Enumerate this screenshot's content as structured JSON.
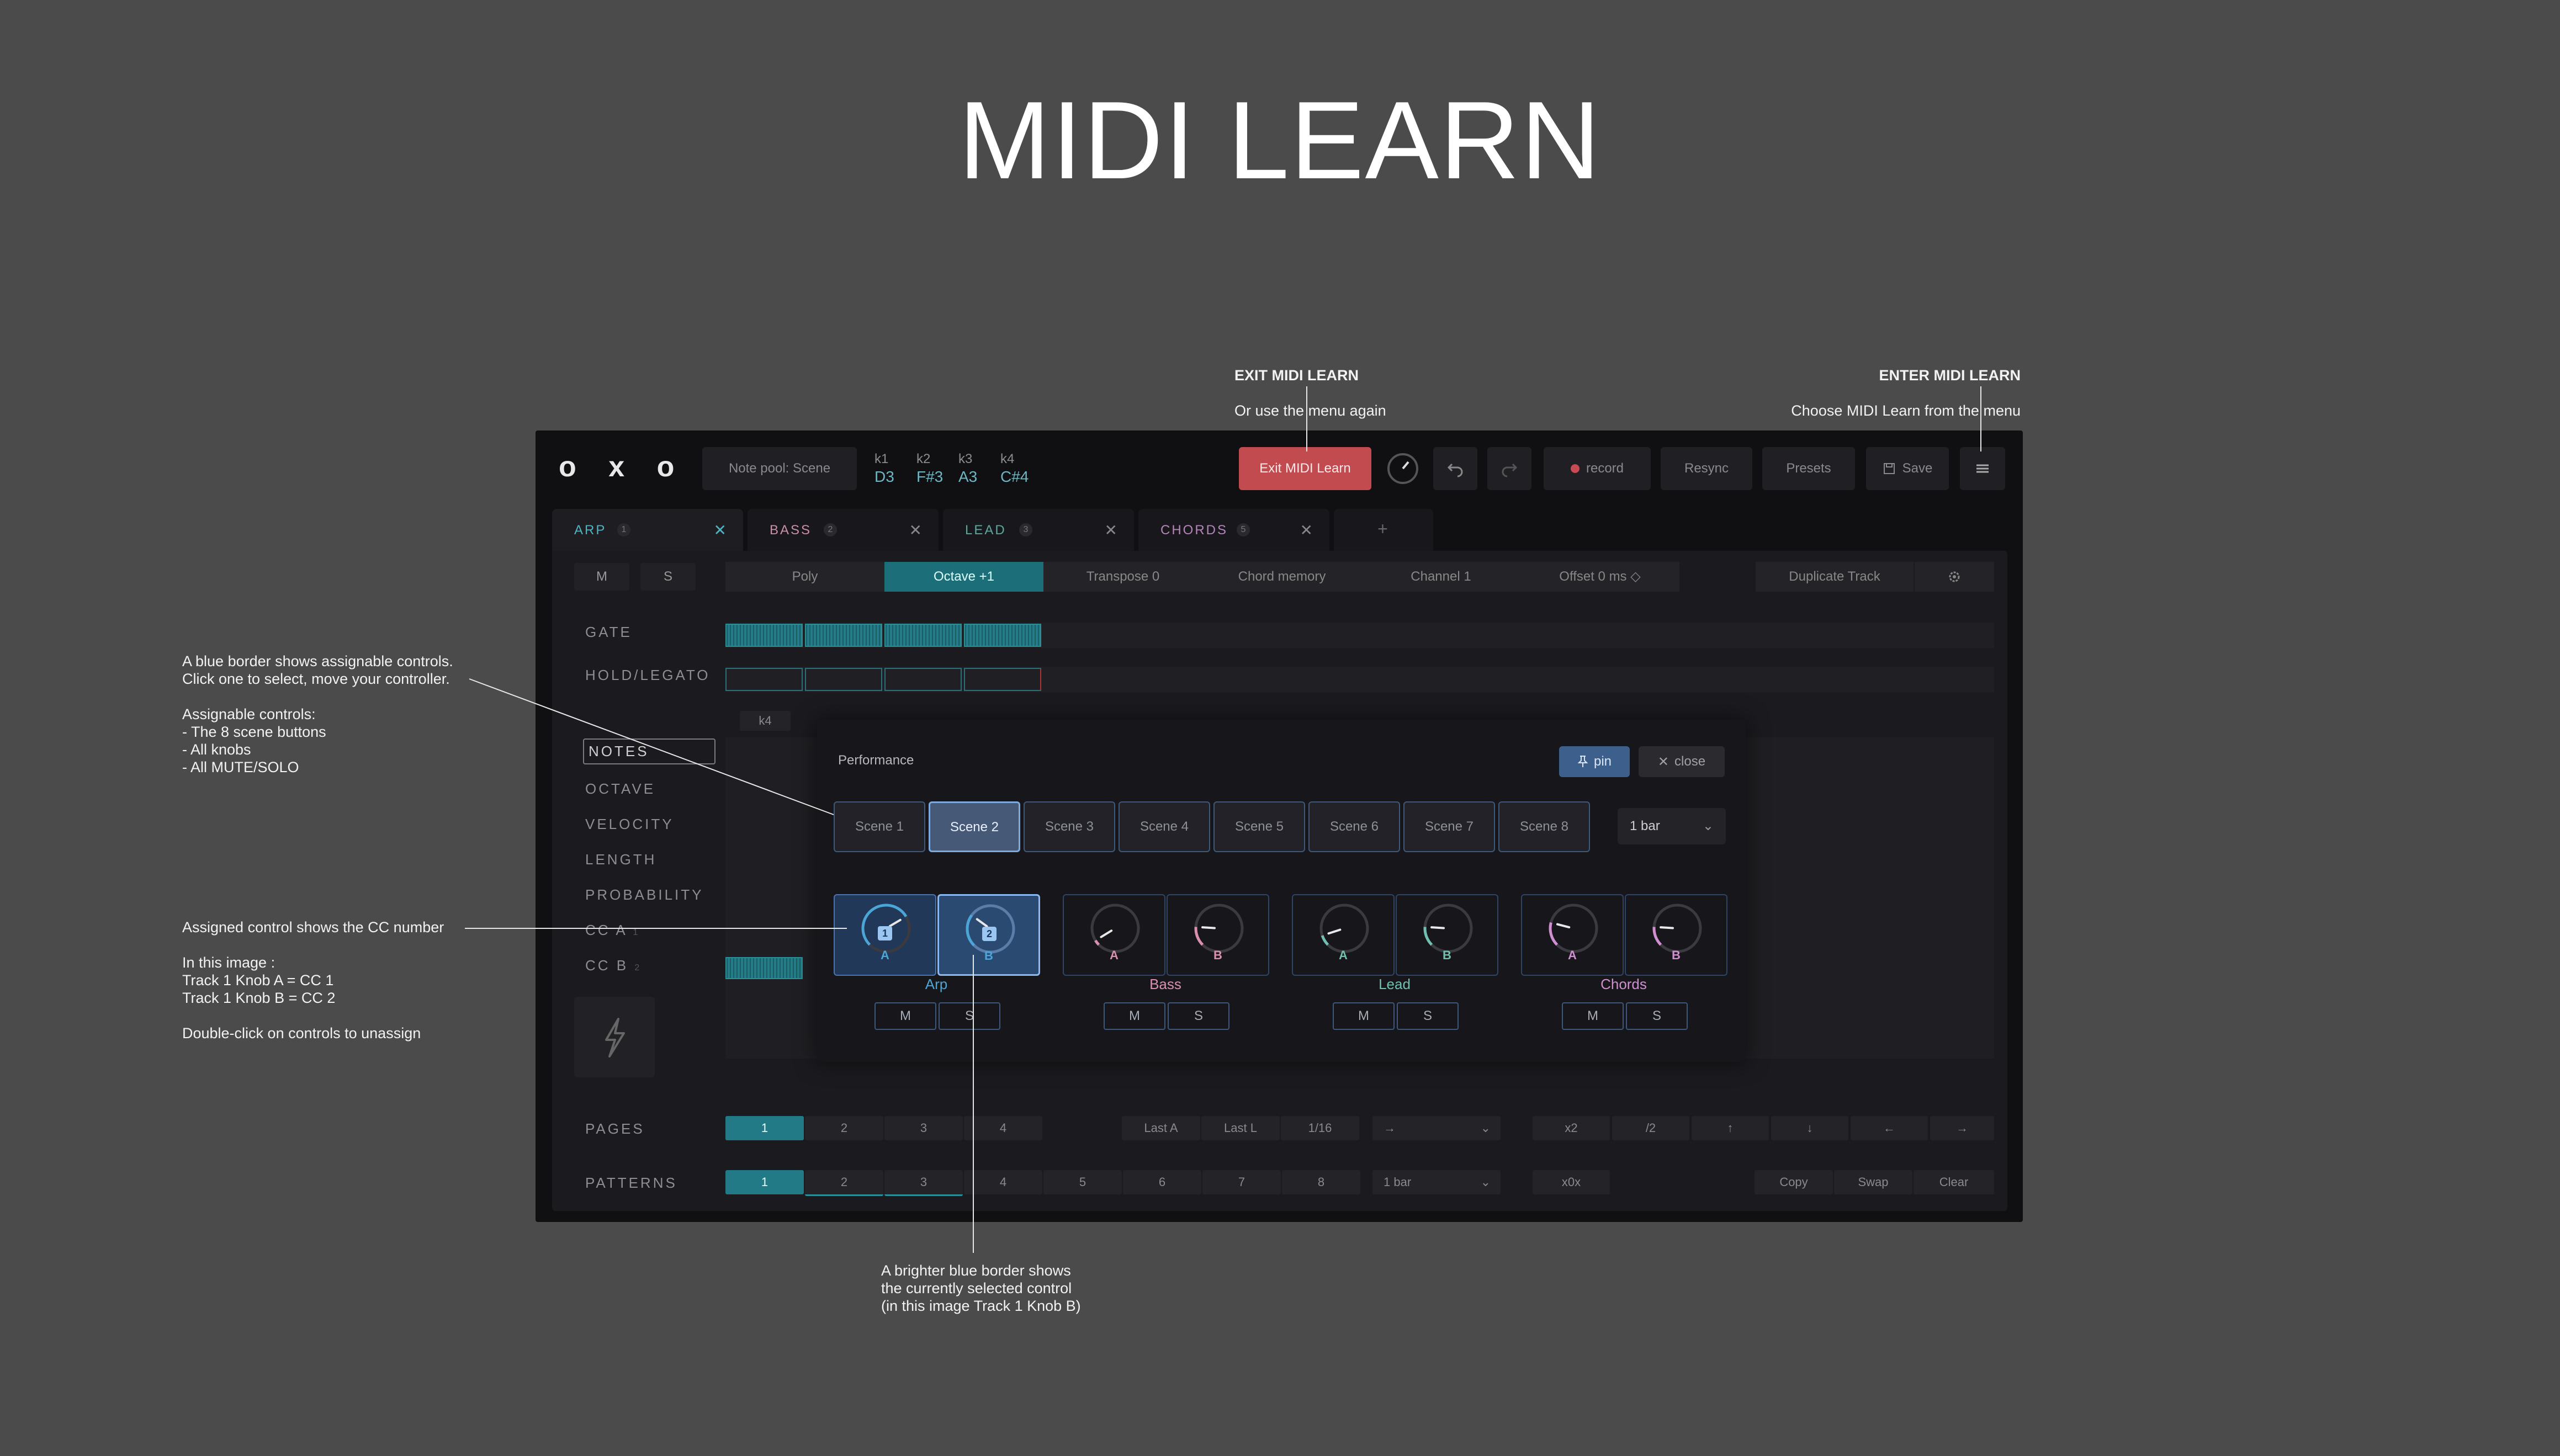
{
  "title": "MIDI LEARN",
  "annotations": {
    "exit": {
      "heading": "EXIT MIDI LEARN",
      "text": "Or use the menu again"
    },
    "enter": {
      "heading": "ENTER MIDI LEARN",
      "text": "Choose MIDI Learn from the menu"
    },
    "blue_border": {
      "text": "A blue border shows assignable controls.\nClick one to select, move your controller.\n\nAssignable controls:\n- The 8 scene buttons\n- All knobs\n- All MUTE/SOLO"
    },
    "assigned": {
      "text": "Assigned control shows the CC number\n\nIn this image :\nTrack 1 Knob A = CC 1\nTrack 1 Knob B = CC 2\n\nDouble-click on controls to unassign"
    },
    "brighter": {
      "text": "A brighter blue border shows\nthe currently selected control\n(in this image Track 1 Knob B)"
    }
  },
  "app": {
    "logo": "o x o",
    "note_pool": "Note pool: Scene",
    "keys": [
      {
        "label": "k1",
        "note": "D3"
      },
      {
        "label": "k2",
        "note": "F#3"
      },
      {
        "label": "k3",
        "note": "A3"
      },
      {
        "label": "k4",
        "note": "C#4"
      }
    ],
    "exit_midi_learn": "Exit MIDI Learn",
    "record": "record",
    "resync": "Resync",
    "presets": "Presets",
    "save": "Save",
    "tabs": [
      {
        "name": "ARP",
        "num": "1",
        "color": "#4fb3c2"
      },
      {
        "name": "BASS",
        "num": "2",
        "color": "#c98fa6"
      },
      {
        "name": "LEAD",
        "num": "3",
        "color": "#5fa79d"
      },
      {
        "name": "CHORDS",
        "num": "5",
        "color": "#b586b9"
      }
    ],
    "add_tab": "+",
    "mute": "M",
    "solo": "S",
    "options": [
      "Poly",
      "Octave +1",
      "Transpose 0",
      "Chord memory",
      "Channel 1",
      "Offset 0 ms ◇"
    ],
    "duplicate_track": "Duplicate Track",
    "side_labels": [
      "GATE",
      "HOLD/LEGATO",
      "NOTES",
      "OCTAVE",
      "VELOCITY",
      "LENGTH",
      "PROBABILITY",
      "CC A",
      "CC B"
    ],
    "cc_a_num": "1",
    "cc_b_num": "2",
    "k4_chip": "k4",
    "pages_label": "PAGES",
    "pages": [
      "1",
      "2",
      "3",
      "4"
    ],
    "page_opts": [
      "Last A",
      "Last L",
      "1/16"
    ],
    "arrow_select": "→",
    "transforms": [
      "x2",
      "/2",
      "↑",
      "↓",
      "←",
      "→"
    ],
    "patterns_label": "PATTERNS",
    "patterns": [
      "1",
      "2",
      "3",
      "4",
      "5",
      "6",
      "7",
      "8"
    ],
    "pattern_len": "1 bar",
    "x0x": "x0x",
    "copy": "Copy",
    "swap": "Swap",
    "clear": "Clear"
  },
  "performance": {
    "title": "Performance",
    "pin": "pin",
    "close": "close",
    "scenes": [
      "Scene 1",
      "Scene 2",
      "Scene 3",
      "Scene 4",
      "Scene 5",
      "Scene 6",
      "Scene 7",
      "Scene 8"
    ],
    "selected_scene": "Scene 2",
    "bar_length": "1 bar",
    "tracks": [
      {
        "name": "Arp",
        "color": "#4aa6d6",
        "knobs": [
          {
            "label": "A",
            "cc": "1",
            "value": 0.72
          },
          {
            "label": "B",
            "cc": "2",
            "value": 0.3
          }
        ]
      },
      {
        "name": "Bass",
        "color": "#d98fb0",
        "knobs": [
          {
            "label": "A",
            "value": 0.05
          },
          {
            "label": "B",
            "value": 0.18
          }
        ]
      },
      {
        "name": "Lead",
        "color": "#6fc0b0",
        "knobs": [
          {
            "label": "A",
            "value": 0.1
          },
          {
            "label": "B",
            "value": 0.18
          }
        ]
      },
      {
        "name": "Chords",
        "color": "#d08fd0",
        "knobs": [
          {
            "label": "A",
            "value": 0.22
          },
          {
            "label": "B",
            "value": 0.18
          }
        ]
      }
    ],
    "mute": "M",
    "solo": "S"
  }
}
